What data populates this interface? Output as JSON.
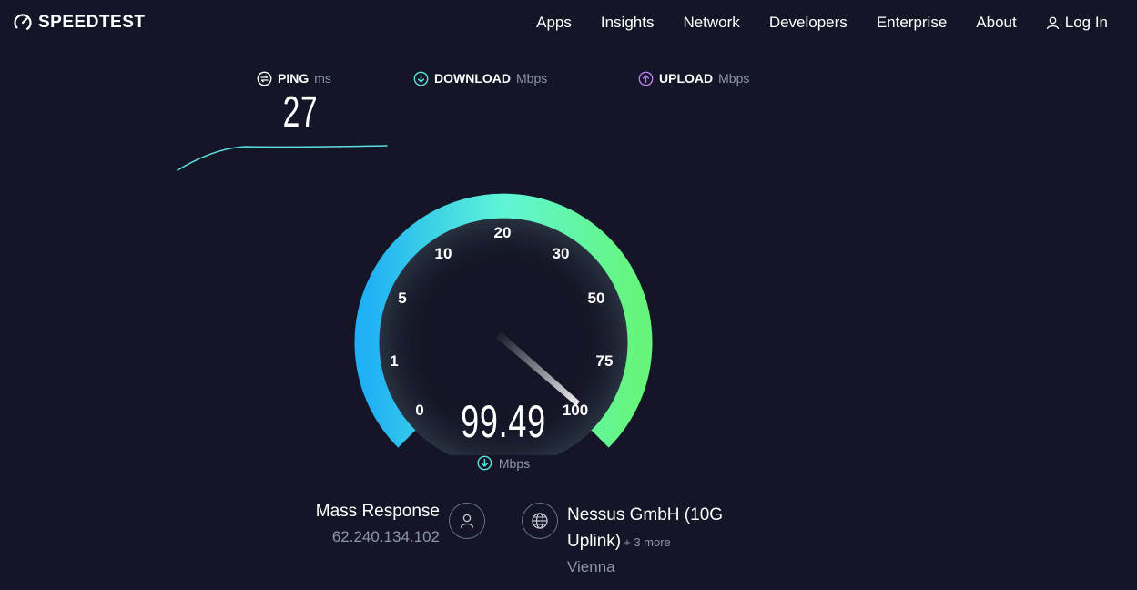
{
  "header": {
    "logo_text": "SPEEDTEST",
    "nav": [
      {
        "label": "Apps"
      },
      {
        "label": "Insights"
      },
      {
        "label": "Network"
      },
      {
        "label": "Developers"
      },
      {
        "label": "Enterprise"
      },
      {
        "label": "About"
      },
      {
        "label": "Log In",
        "icon": "user-icon"
      }
    ]
  },
  "metrics": {
    "ping": {
      "label": "PING",
      "unit": "ms",
      "value": "27",
      "icon": "ping-icon"
    },
    "download": {
      "label": "DOWNLOAD",
      "unit": "Mbps",
      "icon": "download-icon"
    },
    "upload": {
      "label": "UPLOAD",
      "unit": "Mbps",
      "icon": "upload-icon"
    }
  },
  "gauge": {
    "ticks": [
      "0",
      "1",
      "5",
      "10",
      "20",
      "30",
      "50",
      "75",
      "100"
    ],
    "value": "99.49",
    "unit": "Mbps",
    "colors": {
      "start": "#29b6f6",
      "mid": "#5ff5d6",
      "end": "#66f57a"
    }
  },
  "isp": {
    "name": "Mass Response",
    "ip": "62.240.134.102",
    "icon": "user-icon"
  },
  "server": {
    "name": "Nessus GmbH (10G Uplink)",
    "more": "+ 3 more",
    "location": "Vienna",
    "icon": "globe-icon"
  },
  "colors": {
    "background": "#141526",
    "muted_text": "#9193a8",
    "ping_accent": "#ffffff",
    "download_accent": "#5ee0e0",
    "upload_accent": "#c17cf2"
  }
}
